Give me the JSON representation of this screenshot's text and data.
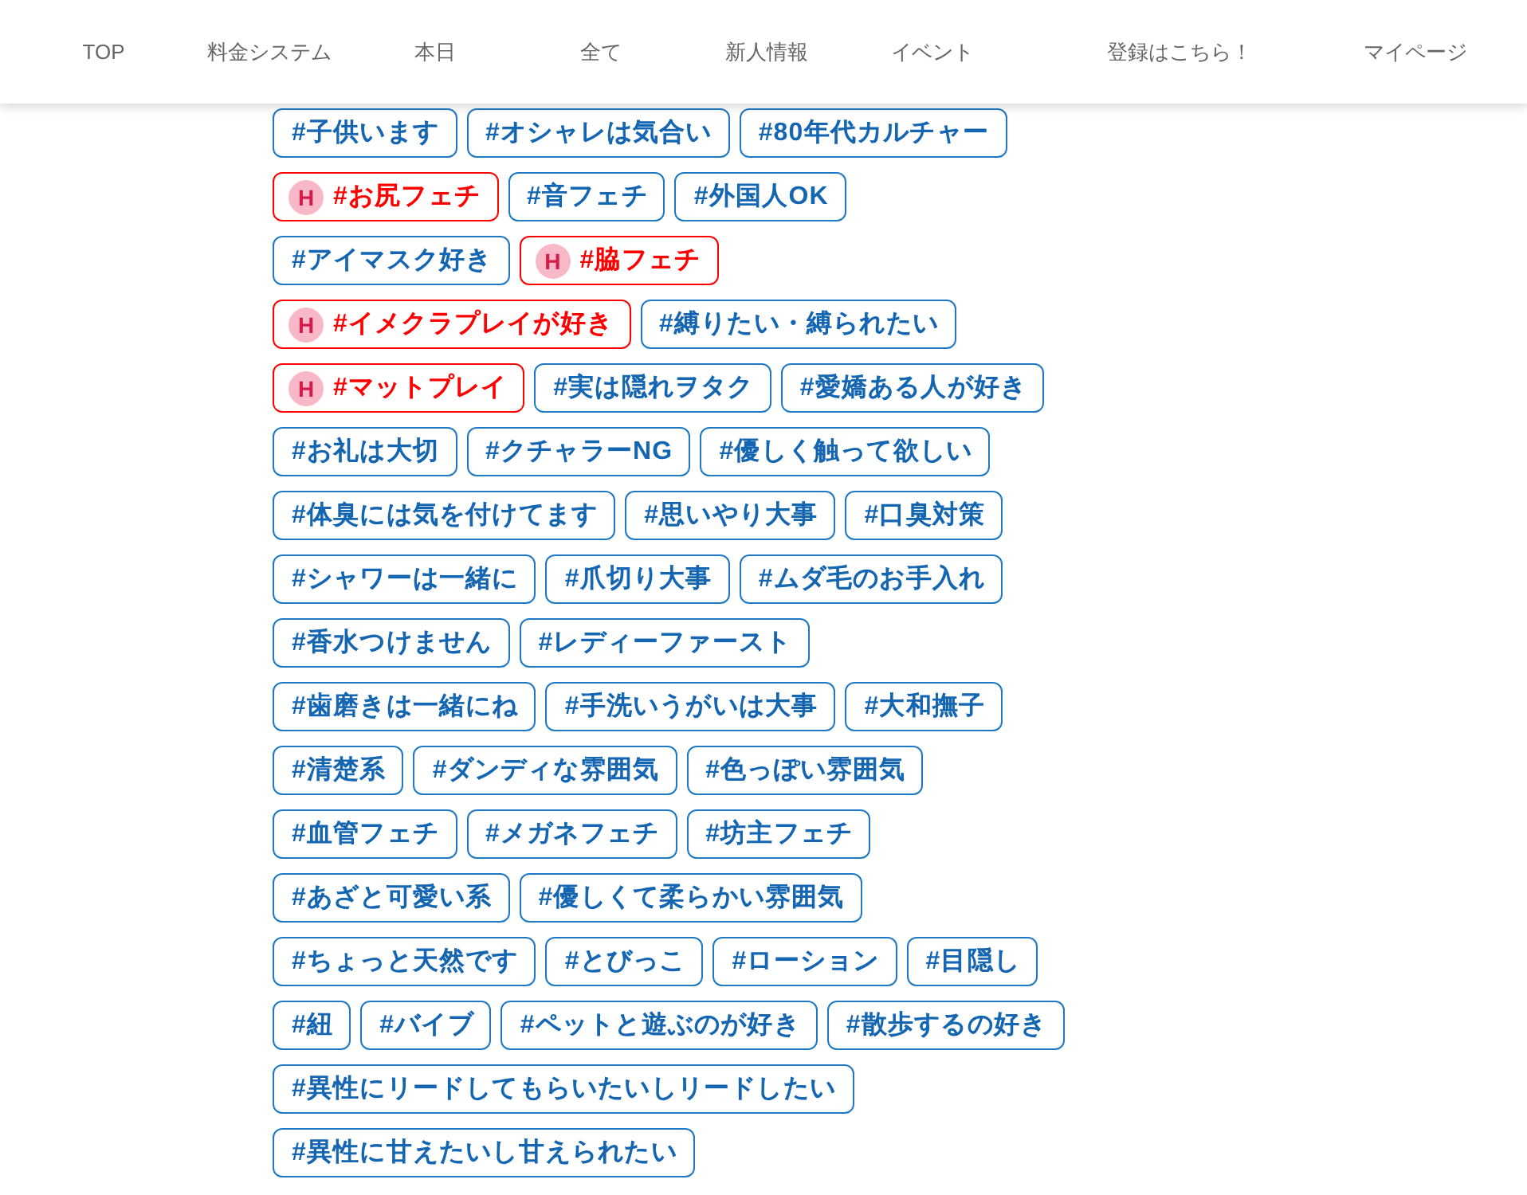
{
  "header": {
    "nav": [
      "TOP",
      "料金システム",
      "本日",
      "全て",
      "新人情報",
      "イベント",
      "登録はこちら！",
      "マイページ"
    ]
  },
  "tag_rows": [
    [
      {
        "label": "#子供います",
        "kind": "normal"
      },
      {
        "label": "#オシャレは気合い",
        "kind": "normal"
      },
      {
        "label": "#80年代カルチャー",
        "kind": "normal"
      }
    ],
    [
      {
        "label": "#お尻フェチ",
        "kind": "hot",
        "badge": "H"
      },
      {
        "label": "#音フェチ",
        "kind": "normal"
      },
      {
        "label": "#外国人OK",
        "kind": "normal"
      }
    ],
    [
      {
        "label": "#アイマスク好き",
        "kind": "normal"
      },
      {
        "label": "#脇フェチ",
        "kind": "hot",
        "badge": "H"
      }
    ],
    [
      {
        "label": "#イメクラプレイが好き",
        "kind": "hot",
        "badge": "H"
      },
      {
        "label": "#縛りたい・縛られたい",
        "kind": "normal"
      }
    ],
    [
      {
        "label": "#マットプレイ",
        "kind": "hot",
        "badge": "H"
      },
      {
        "label": "#実は隠れヲタク",
        "kind": "normal"
      },
      {
        "label": "#愛嬌ある人が好き",
        "kind": "normal"
      }
    ],
    [
      {
        "label": "#お礼は大切",
        "kind": "normal"
      },
      {
        "label": "#クチャラーNG",
        "kind": "normal"
      },
      {
        "label": "#優しく触って欲しい",
        "kind": "normal"
      }
    ],
    [
      {
        "label": "#体臭には気を付けてます",
        "kind": "normal"
      },
      {
        "label": "#思いやり大事",
        "kind": "normal"
      },
      {
        "label": "#口臭対策",
        "kind": "normal"
      }
    ],
    [
      {
        "label": "#シャワーは一緒に",
        "kind": "normal"
      },
      {
        "label": "#爪切り大事",
        "kind": "normal"
      },
      {
        "label": "#ムダ毛のお手入れ",
        "kind": "normal"
      }
    ],
    [
      {
        "label": "#香水つけません",
        "kind": "normal"
      },
      {
        "label": "#レディーファースト",
        "kind": "normal"
      }
    ],
    [
      {
        "label": "#歯磨きは一緒にね",
        "kind": "normal"
      },
      {
        "label": "#手洗いうがいは大事",
        "kind": "normal"
      },
      {
        "label": "#大和撫子",
        "kind": "normal"
      }
    ],
    [
      {
        "label": "#清楚系",
        "kind": "normal"
      },
      {
        "label": "#ダンディな雰囲気",
        "kind": "normal"
      },
      {
        "label": "#色っぽい雰囲気",
        "kind": "normal"
      }
    ],
    [
      {
        "label": "#血管フェチ",
        "kind": "normal"
      },
      {
        "label": "#メガネフェチ",
        "kind": "normal"
      },
      {
        "label": "#坊主フェチ",
        "kind": "normal"
      }
    ],
    [
      {
        "label": "#あざと可愛い系",
        "kind": "normal"
      },
      {
        "label": "#優しくて柔らかい雰囲気",
        "kind": "normal"
      }
    ],
    [
      {
        "label": "#ちょっと天然です",
        "kind": "normal"
      },
      {
        "label": "#とびっこ",
        "kind": "normal"
      },
      {
        "label": "#ローション",
        "kind": "normal"
      },
      {
        "label": "#目隠し",
        "kind": "normal"
      }
    ],
    [
      {
        "label": "#紐",
        "kind": "normal"
      },
      {
        "label": "#バイブ",
        "kind": "normal"
      },
      {
        "label": "#ペットと遊ぶのが好き",
        "kind": "normal"
      },
      {
        "label": "#散歩するの好き",
        "kind": "normal"
      }
    ],
    [
      {
        "label": "#異性にリードしてもらいたいしリードしたい",
        "kind": "normal"
      }
    ],
    [
      {
        "label": "#異性に甘えたいし甘えられたい",
        "kind": "normal"
      }
    ]
  ]
}
